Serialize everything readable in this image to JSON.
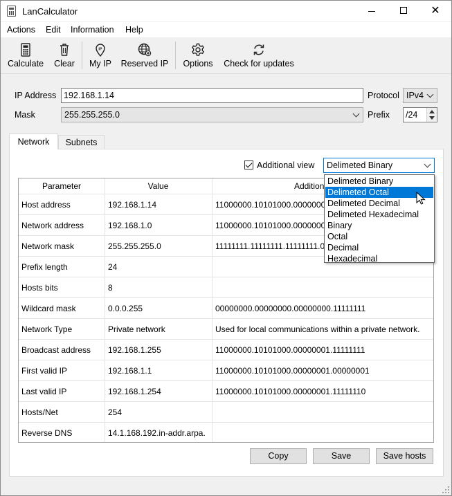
{
  "window": {
    "title": "LanCalculator"
  },
  "menu": [
    "Actions",
    "Edit",
    "Information",
    "Help"
  ],
  "toolbar": {
    "calculate": "Calculate",
    "clear": "Clear",
    "my_ip": "My IP",
    "reserved_ip": "Reserved IP",
    "options": "Options",
    "check_updates": "Check for updates"
  },
  "form": {
    "ip_label": "IP Address",
    "ip_value": "192.168.1.14",
    "protocol_label": "Protocol",
    "protocol_value": "IPv4",
    "mask_label": "Mask",
    "mask_value": "255.255.255.0",
    "prefix_label": "Prefix",
    "prefix_value": "/24"
  },
  "tabs": [
    "Network",
    "Subnets"
  ],
  "additional_view": {
    "label": "Additional view",
    "checked": true,
    "selected": "Delimeted Binary"
  },
  "dropdown_options": [
    "Delimeted Binary",
    "Delimeted Octal",
    "Delimeted Decimal",
    "Delimeted Hexadecimal",
    "Binary",
    "Octal",
    "Decimal",
    "Hexadecimal"
  ],
  "dropdown_highlighted_index": 1,
  "table": {
    "headers": [
      "Parameter",
      "Value",
      "Addition"
    ],
    "rows": [
      [
        "Host address",
        "192.168.1.14",
        "11000000.10101000.00000001.0"
      ],
      [
        "Network address",
        "192.168.1.0",
        "11000000.10101000.00000001.0"
      ],
      [
        "Network mask",
        "255.255.255.0",
        "11111111.11111111.11111111.0"
      ],
      [
        "Prefix length",
        "24",
        ""
      ],
      [
        "Hosts bits",
        "8",
        ""
      ],
      [
        "Wildcard mask",
        "0.0.0.255",
        "00000000.00000000.00000000.11111111"
      ],
      [
        "Network Type",
        "Private network",
        "Used for local communications within a private network."
      ],
      [
        "Broadcast address",
        "192.168.1.255",
        "11000000.10101000.00000001.11111111"
      ],
      [
        "First valid IP",
        "192.168.1.1",
        "11000000.10101000.00000001.00000001"
      ],
      [
        "Last valid IP",
        "192.168.1.254",
        "11000000.10101000.00000001.11111110"
      ],
      [
        "Hosts/Net",
        "254",
        ""
      ],
      [
        "Reverse DNS",
        "14.1.168.192.in-addr.arpa.",
        ""
      ]
    ]
  },
  "buttons": {
    "copy": "Copy",
    "save": "Save",
    "save_hosts": "Save hosts"
  }
}
